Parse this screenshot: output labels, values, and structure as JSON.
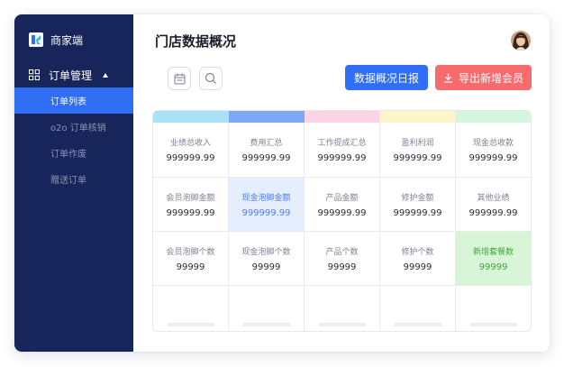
{
  "app": {
    "brand_name": "商家端"
  },
  "sidebar": {
    "group": {
      "label": "订单管理",
      "icon": "grid-icon",
      "expanded": true
    },
    "items": [
      {
        "label": "订单列表",
        "active": true
      },
      {
        "label": "o2o 订单核销",
        "active": false
      },
      {
        "label": "订单作废",
        "active": false
      },
      {
        "label": "赠送订单",
        "active": false
      }
    ]
  },
  "header": {
    "title": "门店数据概况"
  },
  "toolbar": {
    "calendar_icon": "calendar-icon",
    "search_icon": "search-icon",
    "daily_report_label": "数据概况日报",
    "export_label": "导出新增会员"
  },
  "colors": {
    "sidebar_bg": "#17255a",
    "primary": "#2f6ef5",
    "danger": "#f76b6d",
    "header_strip": [
      "#a9e2f6",
      "#7ea7f7",
      "#fbd5e6",
      "#fcf6cb",
      "#d4f5de"
    ]
  },
  "table": {
    "rows": [
      [
        {
          "label": "业绩总收入",
          "value": "999999.99"
        },
        {
          "label": "费用汇总",
          "value": "999999.99"
        },
        {
          "label": "工作提成汇总",
          "value": "999999.99"
        },
        {
          "label": "盈利利润",
          "value": "999999.99"
        },
        {
          "label": "现金总收款",
          "value": "999999.99"
        }
      ],
      [
        {
          "label": "会员泡脚金额",
          "value": "999999.99"
        },
        {
          "label": "现金泡脚金额",
          "value": "999999.99",
          "highlight": "blue"
        },
        {
          "label": "产品金额",
          "value": "999999.99"
        },
        {
          "label": "修护金额",
          "value": "999999.99"
        },
        {
          "label": "其他业绩",
          "value": "999999.99"
        }
      ],
      [
        {
          "label": "会员泡脚个数",
          "value": "99999"
        },
        {
          "label": "现金泡脚个数",
          "value": "99999"
        },
        {
          "label": "产品个数",
          "value": "99999"
        },
        {
          "label": "修护个数",
          "value": "99999"
        },
        {
          "label": "新增套餐数",
          "value": "99999",
          "highlight": "green"
        }
      ]
    ]
  }
}
